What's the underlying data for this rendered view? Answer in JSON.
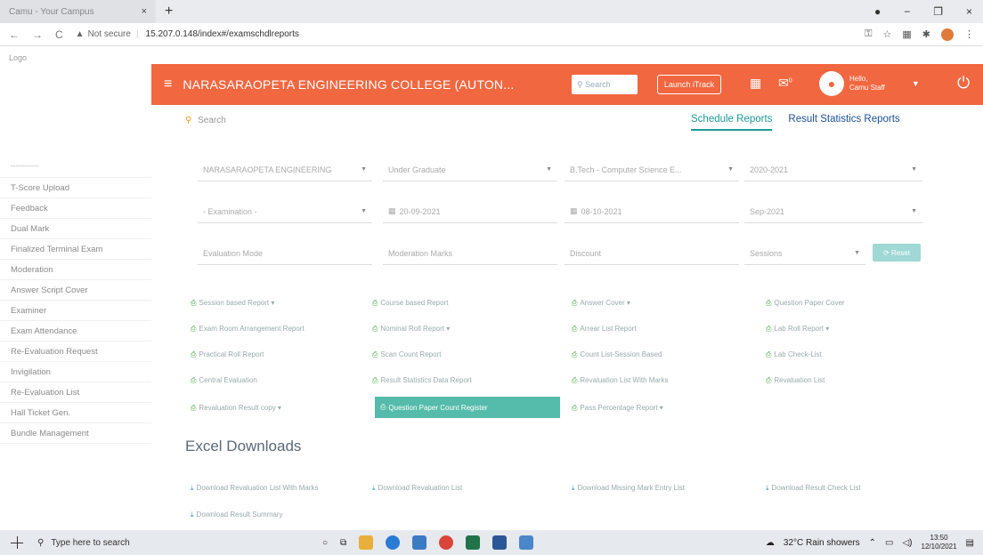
{
  "browser": {
    "tab_title": "Camu - Your Campus",
    "tab_close": "×",
    "new_tab": "+",
    "security": "Not secure",
    "url": "15.207.0.148/index#/examschdlreports",
    "nav_back": "←",
    "nav_forward": "→",
    "nav_reload": "C",
    "win_min": "−",
    "win_max": "❐",
    "win_close": "×"
  },
  "logo_text": "Logo",
  "sidebar": {
    "header": "------------",
    "items": [
      "T-Score Upload",
      "Feedback",
      "Dual Mark",
      "Finalized Terminal Exam",
      "Moderation",
      "Answer Script Cover",
      "Examiner",
      "Exam Attendance",
      "Re-Evaluation Request",
      "Invigilation",
      "Re-Evaluation List",
      "Hall Ticket Gen.",
      "Bundle Management"
    ]
  },
  "header": {
    "college": "NARASARAOPETA ENGINEERING COLLEGE (AUTON...",
    "search_placeholder": "Search",
    "launch": "Launch iTrack",
    "hello": "Hello,",
    "user_name": "Camu Staff",
    "mail_count": "0"
  },
  "page": {
    "search_label": "Search",
    "tab_schedule": "Schedule Reports",
    "tab_result": "Result Statistics Reports"
  },
  "filters": {
    "row1": [
      "NARASARAOPETA ENGINEERING",
      "Under Graduate",
      "B.Tech - Computer Science E...",
      "2020-2021"
    ],
    "row2": [
      "- Examination -",
      "20-09-2021",
      "08-10-2021",
      "Sep-2021"
    ],
    "row3": [
      "Evaluation Mode",
      "Moderation Marks",
      "Discount",
      "Sessions"
    ],
    "reset": "Reset"
  },
  "reports": [
    [
      "Session based Report ▾",
      "Course based Report",
      "Answer Cover ▾",
      "Question Paper Cover"
    ],
    [
      "Exam Room Arrangement Report",
      "Nominal Roll Report ▾",
      "Arrear List Report",
      "Lab Roll Report ▾"
    ],
    [
      "Practical Roll Report",
      "Scan Count Report",
      "Count List-Session Based",
      "Lab Check-List"
    ],
    [
      "Central Evaluation",
      "Result Statistics Data Report",
      "Revaluation List With Marks",
      "Revaluation List"
    ],
    [
      "Revaluation Result copy ▾",
      "Question Paper Count Register",
      "Pass Percentage Report ▾",
      ""
    ]
  ],
  "excel": {
    "title": "Excel Downloads",
    "items": [
      "Download Revaluation List With Marks",
      "Download Revaluation List",
      "Download Missing Mark Entry List",
      "Download Result Check List",
      "Download Result Summary"
    ]
  },
  "taskbar": {
    "search": "Type here to search",
    "weather": "32°C  Rain showers",
    "time": "13:50",
    "date": "12/10/2021"
  }
}
